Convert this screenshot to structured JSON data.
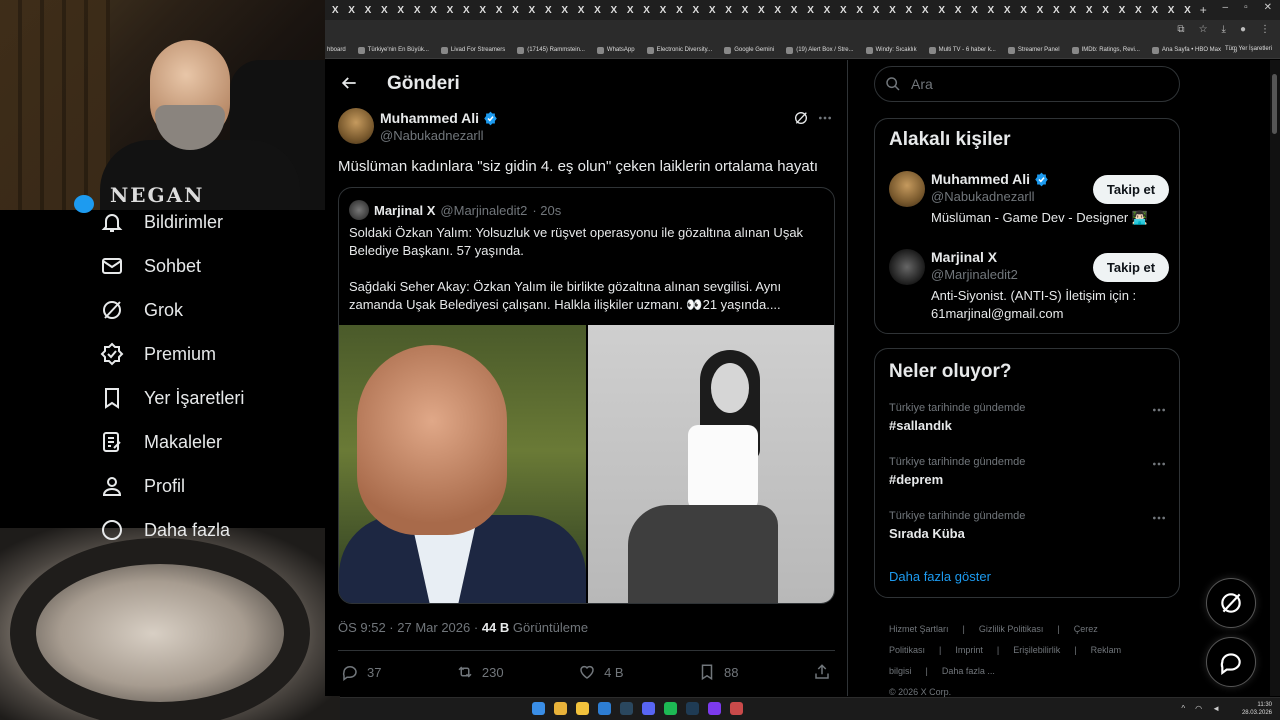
{
  "browser": {
    "tab_labels": [
      "X",
      "X",
      "X",
      "X",
      "X",
      "X",
      "X",
      "X",
      "X",
      "X",
      "X",
      "X",
      "X",
      "X",
      "X",
      "X",
      "X",
      "X",
      "X",
      "X",
      "X",
      "X",
      "X",
      "X",
      "X",
      "X",
      "X",
      "X",
      "X",
      "X",
      "X",
      "X",
      "X",
      "X",
      "X",
      "X",
      "X",
      "X",
      "X",
      "X",
      "X",
      "X",
      "X",
      "X",
      "X",
      "X",
      "X",
      "X",
      "X",
      "X",
      "X",
      "X",
      "X"
    ],
    "new_tab": "+",
    "window_controls": [
      "–",
      "▫",
      "✕"
    ],
    "bookmarks": [
      "hboard",
      "Türkiye'nin En Büyük...",
      "Livad For Streamers",
      "(17145) Rammstein...",
      "WhatsApp",
      "Electronic Diversity...",
      "Google Gemini",
      "(19) Alert Box / Stre...",
      "Windy: Sıcaklık",
      "Multi TV - 6 haber k...",
      "Streamer Panel",
      "IMDb: Ratings, Revi...",
      "Ana Sayfa • HBO Max"
    ],
    "bookmarks_more": "»",
    "bookmarks_folder": "Tüm Yer İşaretleri"
  },
  "webcam": {
    "overlay_logo": "NEGAN"
  },
  "leftnav": {
    "items": [
      {
        "label": "Bildirimler",
        "icon": "bell-icon"
      },
      {
        "label": "Sohbet",
        "icon": "mail-icon"
      },
      {
        "label": "Grok",
        "icon": "grok-icon"
      },
      {
        "label": "Premium",
        "icon": "verified-badge-icon"
      },
      {
        "label": "Yer İşaretleri",
        "icon": "bookmark-icon"
      },
      {
        "label": "Makaleler",
        "icon": "article-icon"
      },
      {
        "label": "Profil",
        "icon": "person-icon"
      },
      {
        "label": "Daha fazla",
        "icon": "more-circle-icon"
      }
    ]
  },
  "main": {
    "header_title": "Gönderi",
    "post": {
      "author_name": "Muhammed Ali",
      "author_handle": "@Nabukadnezarll",
      "text": "Müslüman kadınlara \"siz gidin 4. eş olun\" çeken laiklerin ortalama hayatı",
      "quote": {
        "name": "Marjinal X",
        "handle": "@Marjinaledit2",
        "time": "· 20s",
        "paragraph1": "Soldaki Özkan Yalım: Yolsuzluk ve rüşvet operasyonu ile gözaltına alınan Uşak Belediye Başkanı. 57 yaşında.",
        "paragraph2": "Sağdaki Seher Akay: Özkan Yalım ile birlikte gözaltına alınan sevgilisi.  Aynı zamanda Uşak Belediyesi çalışanı. Halkla ilişkiler uzmanı. 👀21 yaşında...."
      },
      "timestamp": "ÖS 9:52 · 27 Mar 2026 ·",
      "views_count": "44 B",
      "views_label": "Görüntüleme",
      "replies": "37",
      "reposts": "230",
      "likes": "4 B",
      "bookmarks": "88"
    }
  },
  "right": {
    "search_placeholder": "Ara",
    "related_title": "Alakalı kişiler",
    "people": [
      {
        "name": "Muhammed Ali",
        "handle": "@Nabukadnezarll",
        "bio": "Müslüman - Game Dev - Designer 👨🏻‍💻",
        "verified": true,
        "follow_label": "Takip et"
      },
      {
        "name": "Marjinal X",
        "handle": "@Marjinaledit2",
        "bio": "Anti-Siyonist. (ANTI-S) İletişim için : 61marjinal@gmail.com",
        "verified": false,
        "follow_label": "Takip et"
      }
    ],
    "trends_title": "Neler oluyor?",
    "trends": [
      {
        "context": "Türkiye tarihinde gündemde",
        "name": "#sallandık"
      },
      {
        "context": "Türkiye tarihinde gündemde",
        "name": "#deprem"
      },
      {
        "context": "Türkiye tarihinde gündemde",
        "name": "Sırada Küba"
      }
    ],
    "show_more": "Daha fazla göster",
    "footer_links": [
      "Hizmet Şartları",
      "|",
      "Gizlilik Politikası",
      "|",
      "Çerez Politikası",
      "|",
      "Imprint",
      "|",
      "Erişilebilirlik",
      "|",
      "Reklam bilgisi",
      "|",
      "Daha fazla ..."
    ],
    "copyright": "© 2026 X Corp."
  },
  "taskbar": {
    "time": "11:30",
    "date": "28.03.2026"
  },
  "colors": {
    "accent": "#1d9bf0",
    "background": "#000000",
    "border": "#2f3336",
    "secondary_text": "#71767b"
  }
}
